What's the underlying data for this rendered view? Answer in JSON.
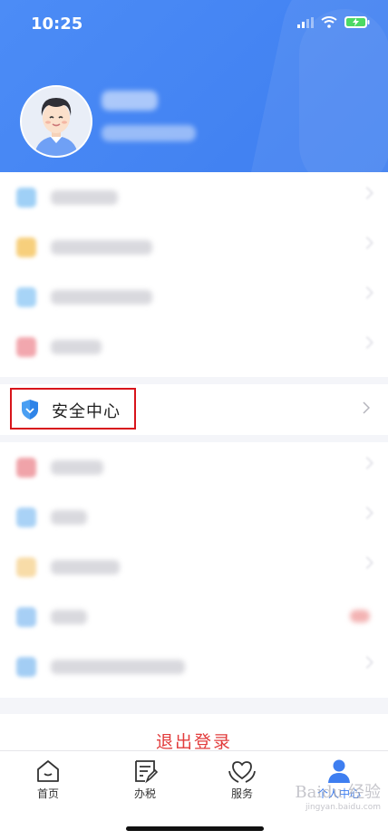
{
  "status_bar": {
    "time": "10:25"
  },
  "profile": {
    "avatar_icon": "user-avatar-icon"
  },
  "menu_group_1": [
    "blurred-item",
    "blurred-item",
    "blurred-item",
    "blurred-item"
  ],
  "security_center": {
    "label": "安全中心",
    "icon": "shield-check-icon"
  },
  "menu_group_2": [
    "blurred-item",
    "blurred-item",
    "blurred-item",
    "blurred-item",
    "blurred-item"
  ],
  "logout": {
    "label": "退出登录"
  },
  "tabs": [
    {
      "label": "首页",
      "icon": "home-icon"
    },
    {
      "label": "办税",
      "icon": "document-edit-icon"
    },
    {
      "label": "服务",
      "icon": "heart-hands-icon"
    },
    {
      "label": "个人中心",
      "icon": "person-icon",
      "active": true
    }
  ],
  "colors": {
    "brand": "#3e7ef0",
    "active_tab": "#3e7ef0",
    "logout": "#e23c3c",
    "highlight_box": "#d8141b"
  }
}
